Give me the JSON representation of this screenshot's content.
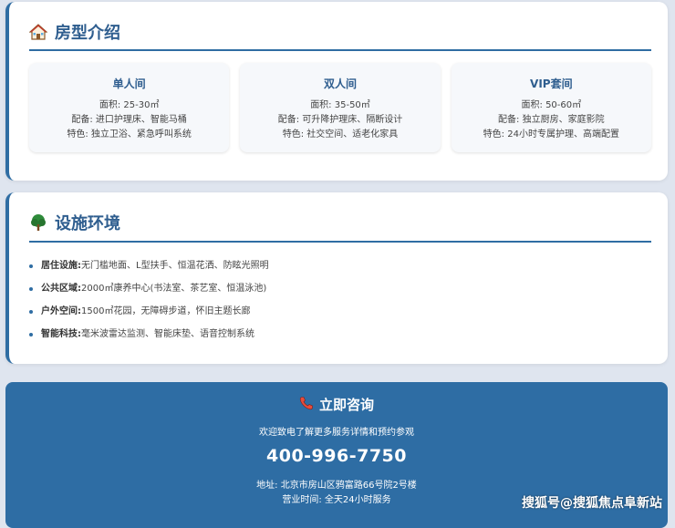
{
  "rooms": {
    "title": "房型介绍",
    "icon": "house-icon",
    "items": [
      {
        "name": "单人间",
        "area": "面积: 25-30㎡",
        "config": "配备: 进口护理床、智能马桶",
        "feature": "特色: 独立卫浴、紧急呼叫系统"
      },
      {
        "name": "双人间",
        "area": "面积: 35-50㎡",
        "config": "配备: 可升降护理床、隔断设计",
        "feature": "特色: 社交空间、适老化家具"
      },
      {
        "name": "VIP套间",
        "area": "面积: 50-60㎡",
        "config": "配备: 独立厨房、家庭影院",
        "feature": "特色: 24小时专属护理、高端配置"
      }
    ]
  },
  "facilities": {
    "title": "设施环境",
    "icon": "tree-icon",
    "items": [
      {
        "label": "居住设施:",
        "text": " 无门槛地面、L型扶手、恒温花洒、防眩光照明"
      },
      {
        "label": "公共区域:",
        "text": " 2000㎡康养中心(书法室、茶艺室、恒温泳池)"
      },
      {
        "label": "户外空间:",
        "text": " 1500㎡花园，无障碍步道，怀旧主题长廊"
      },
      {
        "label": "智能科技:",
        "text": " 毫米波雷达监测、智能床垫、语音控制系统"
      }
    ]
  },
  "contact": {
    "title": "立即咨询",
    "icon": "phone-icon",
    "description": "欢迎致电了解更多服务详情和预约参观",
    "phone": "400-996-7750",
    "address": "地址: 北京市房山区鸦富路66号院2号楼",
    "hours": "营业时间: 全天24小时服务"
  },
  "watermark": "搜狐号@搜狐焦点阜新站",
  "colors": {
    "accent": "#2f6da3",
    "title": "#2f5e8f",
    "banner": "#2e6da4"
  }
}
